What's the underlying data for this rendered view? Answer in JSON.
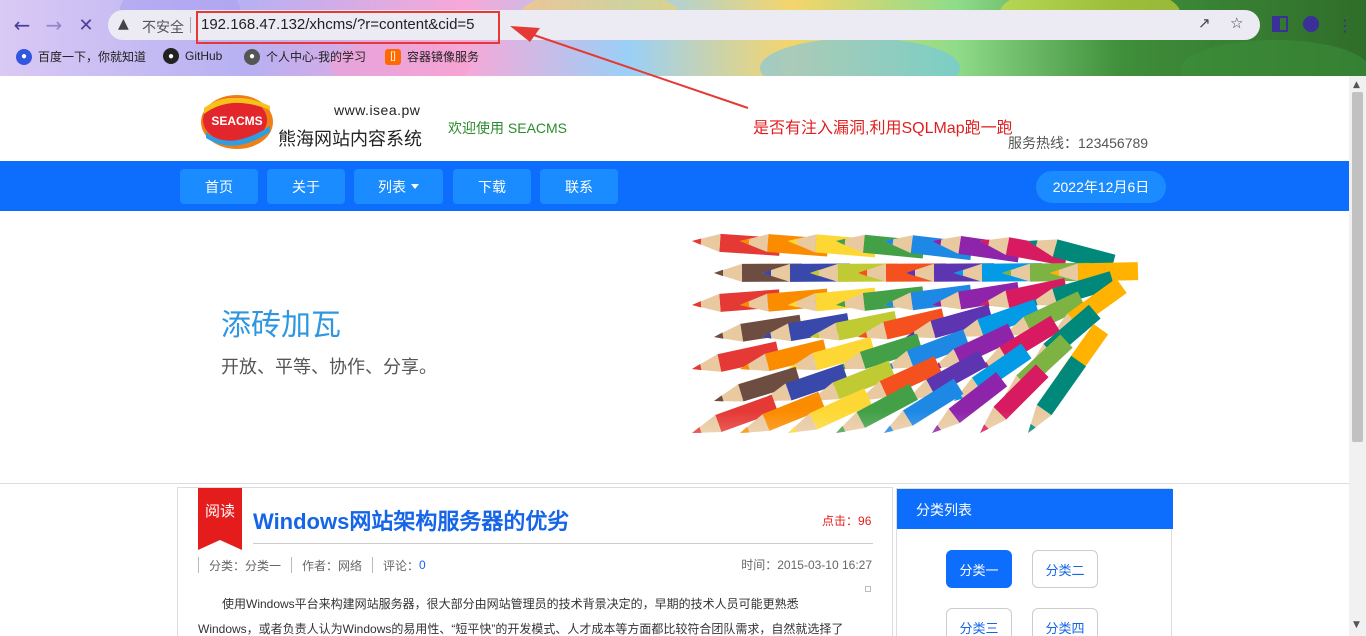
{
  "browser": {
    "omnibox": {
      "security_label": "不安全",
      "url": "192.168.47.132/xhcms/?r=content&cid=5"
    },
    "bookmarks": [
      {
        "label": "百度一下，你就知道",
        "icon": "baidu-paw-icon"
      },
      {
        "label": "GitHub",
        "icon": "github-icon"
      },
      {
        "label": "个人中心-我的学习",
        "icon": "globe-icon"
      },
      {
        "label": "容器镜像服务",
        "icon": "aliyun-bracket-icon"
      }
    ]
  },
  "annotation": {
    "text": "是否有注入漏洞,利用SQLMap跑一跑",
    "color": "#e02020"
  },
  "site": {
    "logo_text": "SEACMS",
    "logo_url": "www.isea.pw",
    "logo_name": "熊海网站内容系统",
    "welcome": "欢迎使用 SEACMS",
    "hotline": "服务热线：123456789",
    "nav": [
      {
        "label": "首页"
      },
      {
        "label": "关于"
      },
      {
        "label": "列表"
      },
      {
        "label": "下载"
      },
      {
        "label": "联系"
      }
    ],
    "date": "2022年12月6日",
    "brand_color": "#0d6efd"
  },
  "hero": {
    "title": "添砖加瓦",
    "subtitle": "开放、平等、协作、分享。"
  },
  "article": {
    "badge": "阅读",
    "title": "Windows网站架构服务器的优劣",
    "hits_label": "点击：",
    "hits": "96",
    "category": "分类：分类一",
    "author": "作者：网络",
    "comments_label": "评论：",
    "comments": "0",
    "time": "时间：2015-03-10 16:27",
    "body_lines": [
      "使用Windows平台来构建网站服务器，很大部分由网站管理员的技术背景决定的，早期的技术人员可能更熟悉",
      "Windows，或者负责人认为Windows的易用性、“短平快”的开发模式、人才成本等方面都比较符合团队需求，自然就选择了"
    ]
  },
  "sidebar": {
    "title": "分类列表",
    "categories": [
      {
        "label": "分类一",
        "active": true
      },
      {
        "label": "分类二",
        "active": false
      },
      {
        "label": "分类三",
        "active": false
      },
      {
        "label": "分类四",
        "active": false
      }
    ]
  }
}
